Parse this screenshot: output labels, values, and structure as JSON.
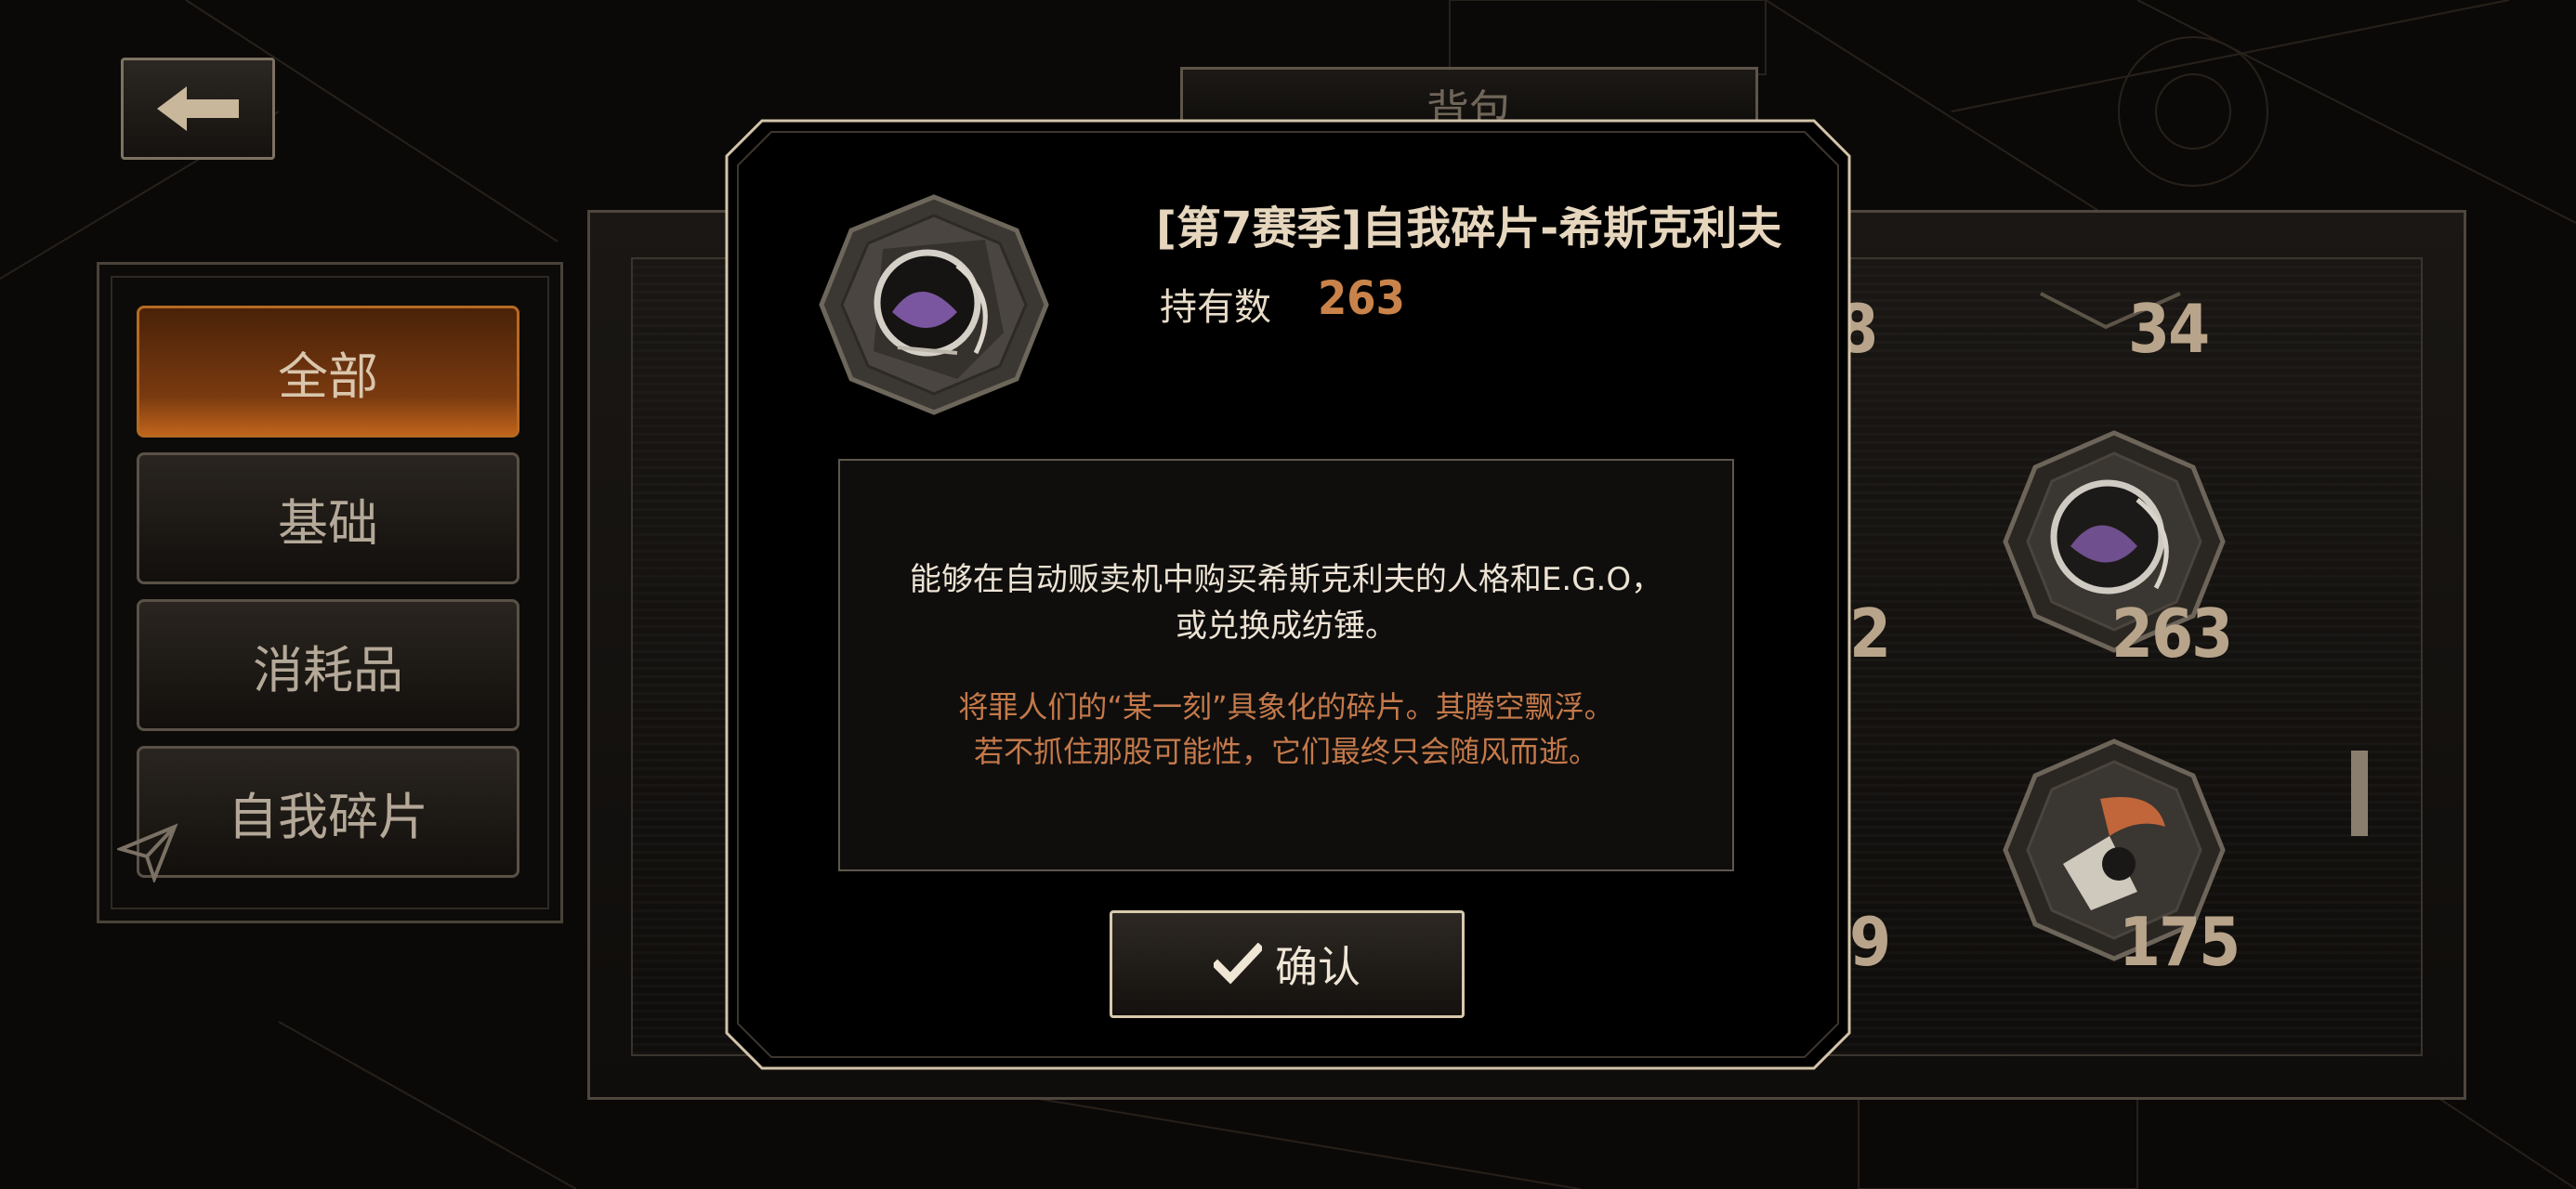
{
  "screen": {
    "title": "背包"
  },
  "back_button": {
    "icon": "back-arrow-icon"
  },
  "categories": [
    {
      "label": "全部",
      "active": true
    },
    {
      "label": "基础",
      "active": false
    },
    {
      "label": "消耗品",
      "active": false
    },
    {
      "label": "自我碎片",
      "active": false
    }
  ],
  "inventory": {
    "counts": [
      "8",
      "34",
      "2",
      "263",
      "9",
      "175"
    ]
  },
  "dialog": {
    "item_name_prefix": "[第7赛季]",
    "item_name": "自我碎片-希斯克利夫",
    "owned_label": "持有数",
    "owned_value": "263",
    "desc_line1": "能够在自动贩卖机中购买希斯克利夫的人格和E.G.O，",
    "desc_line2": "或兑换成纺锤。",
    "flavor_line1": "将罪人们的“某一刻”具象化的碎片。其腾空飘浮。",
    "flavor_line2": "若不抓住那股可能性，它们最终只会随风而逝。",
    "confirm_label": "确认",
    "confirm_icon": "check-icon"
  },
  "colors": {
    "accent_orange": "#c9834a",
    "active_tab": "#b66a22",
    "text_light": "#e6d6bd"
  }
}
